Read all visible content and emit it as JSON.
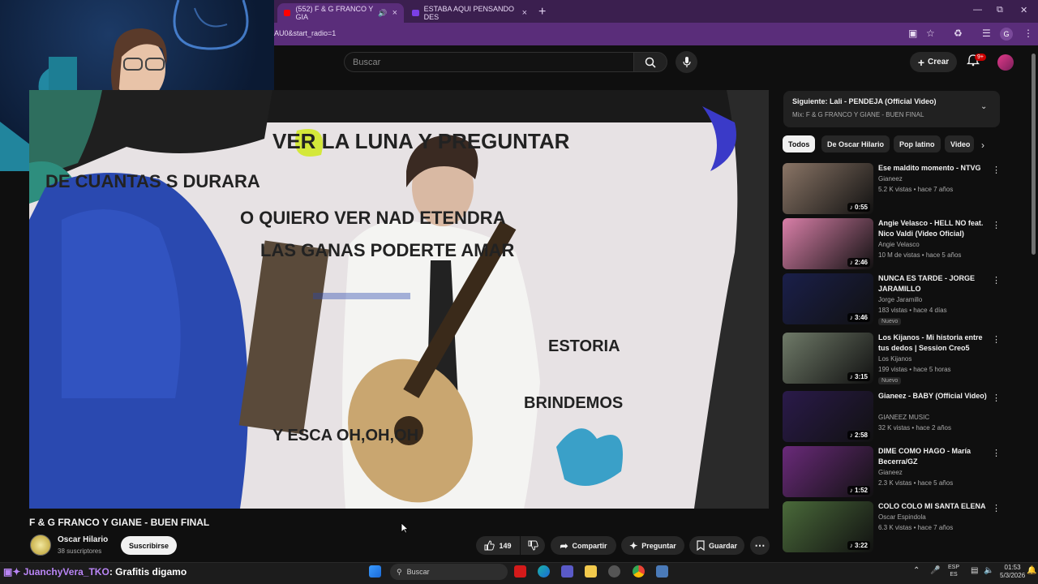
{
  "browser": {
    "tabs": [
      {
        "label": "(552) F & G FRANCO Y GIA",
        "active": true
      },
      {
        "label": "ESTABA AQUI PENSANDO DES",
        "active": false
      }
    ],
    "url": "AU0&start_radio=1",
    "profile_initial": "G"
  },
  "header": {
    "search_placeholder": "Buscar",
    "create_label": "Crear",
    "notifications_badge": "9+"
  },
  "video": {
    "title": "F & G FRANCO Y GIANE - BUEN FINAL",
    "lyrics": [
      "VER LA LUNA Y PREGUNTAR",
      "DE CUANTAS S DURARA",
      "O QUIERO VER NAD ETENDRA",
      "LAS GANAS PODERTE AMAR",
      "ESTORIA",
      "BRINDEMOS",
      "Y ESCA OH,OH,OH"
    ]
  },
  "channel": {
    "name": "Oscar Hilario",
    "subscribers": "38 suscriptores",
    "subscribe_label": "Suscribirse"
  },
  "actions": {
    "likes": "149",
    "share": "Compartir",
    "ask": "Preguntar",
    "save": "Guardar"
  },
  "up_next": {
    "title": "Siguiente: Lali - PENDEJA (Official Video)",
    "subtitle": "Mix: F & G FRANCO Y GIANE - BUEN FINAL"
  },
  "chips": [
    "Todos",
    "De Oscar Hilario",
    "Pop latino",
    "Video"
  ],
  "recommendations": [
    {
      "title": "Ese maldito momento - NTVG",
      "channel": "Gianeez",
      "meta": "5.2 K vistas • hace 7 años",
      "duration": "0:55",
      "badge": "",
      "color": "#8a7566"
    },
    {
      "title": "Angie Velasco - HELL NO feat. Nico Valdi (Video Oficial)",
      "channel": "Angie Velasco",
      "meta": "10 M de vistas • hace 5 años",
      "duration": "2:46",
      "badge": "",
      "color": "#d97fa8"
    },
    {
      "title": "NUNCA ES TARDE - JORGE JARAMILLO",
      "channel": "Jorge Jaramillo",
      "meta": "183 vistas • hace 4 días",
      "duration": "3:46",
      "badge": "Nuevo",
      "color": "#1a1f4a"
    },
    {
      "title": "Los Kijanos - Mi historia entre tus dedos | Session Creo5",
      "channel": "Los Kijanos",
      "meta": "199 vistas • hace 5 horas",
      "duration": "3:15",
      "badge": "Nuevo",
      "color": "#6f7a68"
    },
    {
      "title": "Gianeez - BABY (Official Video)",
      "channel": "GIANEEZ MUSIC",
      "meta": "32 K vistas • hace 2 años",
      "duration": "2:58",
      "badge": "",
      "color": "#2a1a4a"
    },
    {
      "title": "DIME COMO HAGO - María Becerra/GZ",
      "channel": "Gianeez",
      "meta": "2.3 K vistas • hace 5 años",
      "duration": "1:52",
      "badge": "",
      "color": "#6a2a7a"
    },
    {
      "title": "COLO COLO MI SANTA ELENA",
      "channel": "Oscar Espindola",
      "meta": "6.3 K vistas • hace 7 años",
      "duration": "3:22",
      "badge": "",
      "color": "#4a6a3a"
    }
  ],
  "overlay": {
    "chat_user": "JuanchyVera_TKO",
    "chat_message": ": Grafitis digamo",
    "webcam_caption": ""
  },
  "taskbar": {
    "search_placeholder": "Buscar",
    "lang_top": "ESP",
    "lang_bottom": "ES",
    "time": "01:53",
    "date": "5/3/2026"
  }
}
